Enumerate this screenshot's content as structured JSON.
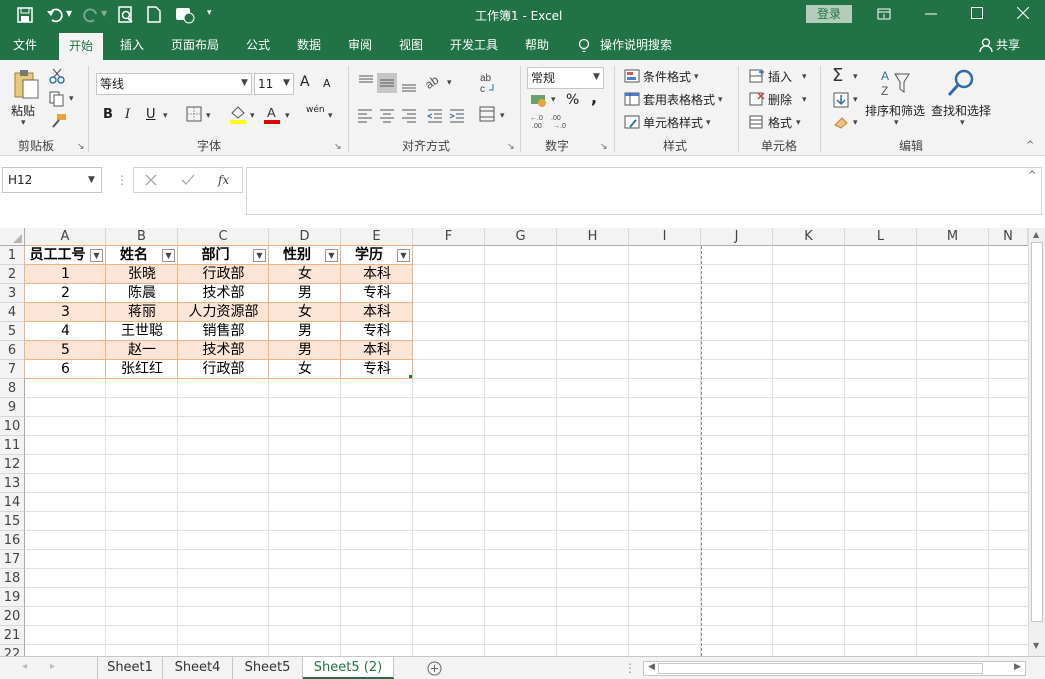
{
  "window": {
    "title": "工作簿1  -  Excel",
    "login_label": "登录"
  },
  "ribbon_tabs": [
    "文件",
    "开始",
    "插入",
    "页面布局",
    "公式",
    "数据",
    "审阅",
    "视图",
    "开发工具",
    "帮助"
  ],
  "tell_me": "操作说明搜索",
  "share_label": "共享",
  "ribbon": {
    "clipboard": {
      "paste": "粘贴",
      "group": "剪贴板"
    },
    "font": {
      "name": "等线",
      "size": "11",
      "bold": "B",
      "italic": "I",
      "underline": "U",
      "grow": "A",
      "shrink": "A",
      "pinyin": "wén",
      "group": "字体"
    },
    "alignment": {
      "group": "对齐方式"
    },
    "number": {
      "format": "常规",
      "percent": "%",
      "comma": ",",
      "group": "数字"
    },
    "styles": {
      "conditional": "条件格式",
      "table": "套用表格格式",
      "cell": "单元格样式",
      "group": "样式"
    },
    "cells": {
      "insert": "插入",
      "delete": "删除",
      "format": "格式",
      "group": "单元格"
    },
    "editing": {
      "sort": "排序和筛选",
      "find": "查找和选择",
      "group": "编辑"
    }
  },
  "formula_bar": {
    "name_box": "H12",
    "fx": "fx",
    "value": ""
  },
  "columns": [
    "A",
    "B",
    "C",
    "D",
    "E",
    "F",
    "G",
    "H",
    "I",
    "J",
    "K",
    "L",
    "M",
    "N"
  ],
  "rows": [
    "1",
    "2",
    "3",
    "4",
    "5",
    "6",
    "7",
    "8",
    "9",
    "10",
    "11",
    "12",
    "13",
    "14",
    "15",
    "16",
    "17",
    "18",
    "19",
    "20",
    "21",
    "22"
  ],
  "table": {
    "headers": [
      "员工工号",
      "姓名",
      "部门",
      "性别",
      "学历"
    ],
    "rows": [
      [
        "1",
        "张晓",
        "行政部",
        "女",
        "本科"
      ],
      [
        "2",
        "陈晨",
        "技术部",
        "男",
        "专科"
      ],
      [
        "3",
        "蒋丽",
        "人力资源部",
        "女",
        "本科"
      ],
      [
        "4",
        "王世聪",
        "销售部",
        "男",
        "专科"
      ],
      [
        "5",
        "赵一",
        "技术部",
        "男",
        "本科"
      ],
      [
        "6",
        "张红红",
        "行政部",
        "女",
        "专科"
      ]
    ]
  },
  "sheets": [
    "Sheet1",
    "Sheet4",
    "Sheet5",
    "Sheet5 (2)"
  ],
  "active_sheet": "Sheet5 (2)",
  "colors": {
    "brand": "#217346",
    "band": "#fce4d6",
    "table_border": "#f4b183"
  }
}
